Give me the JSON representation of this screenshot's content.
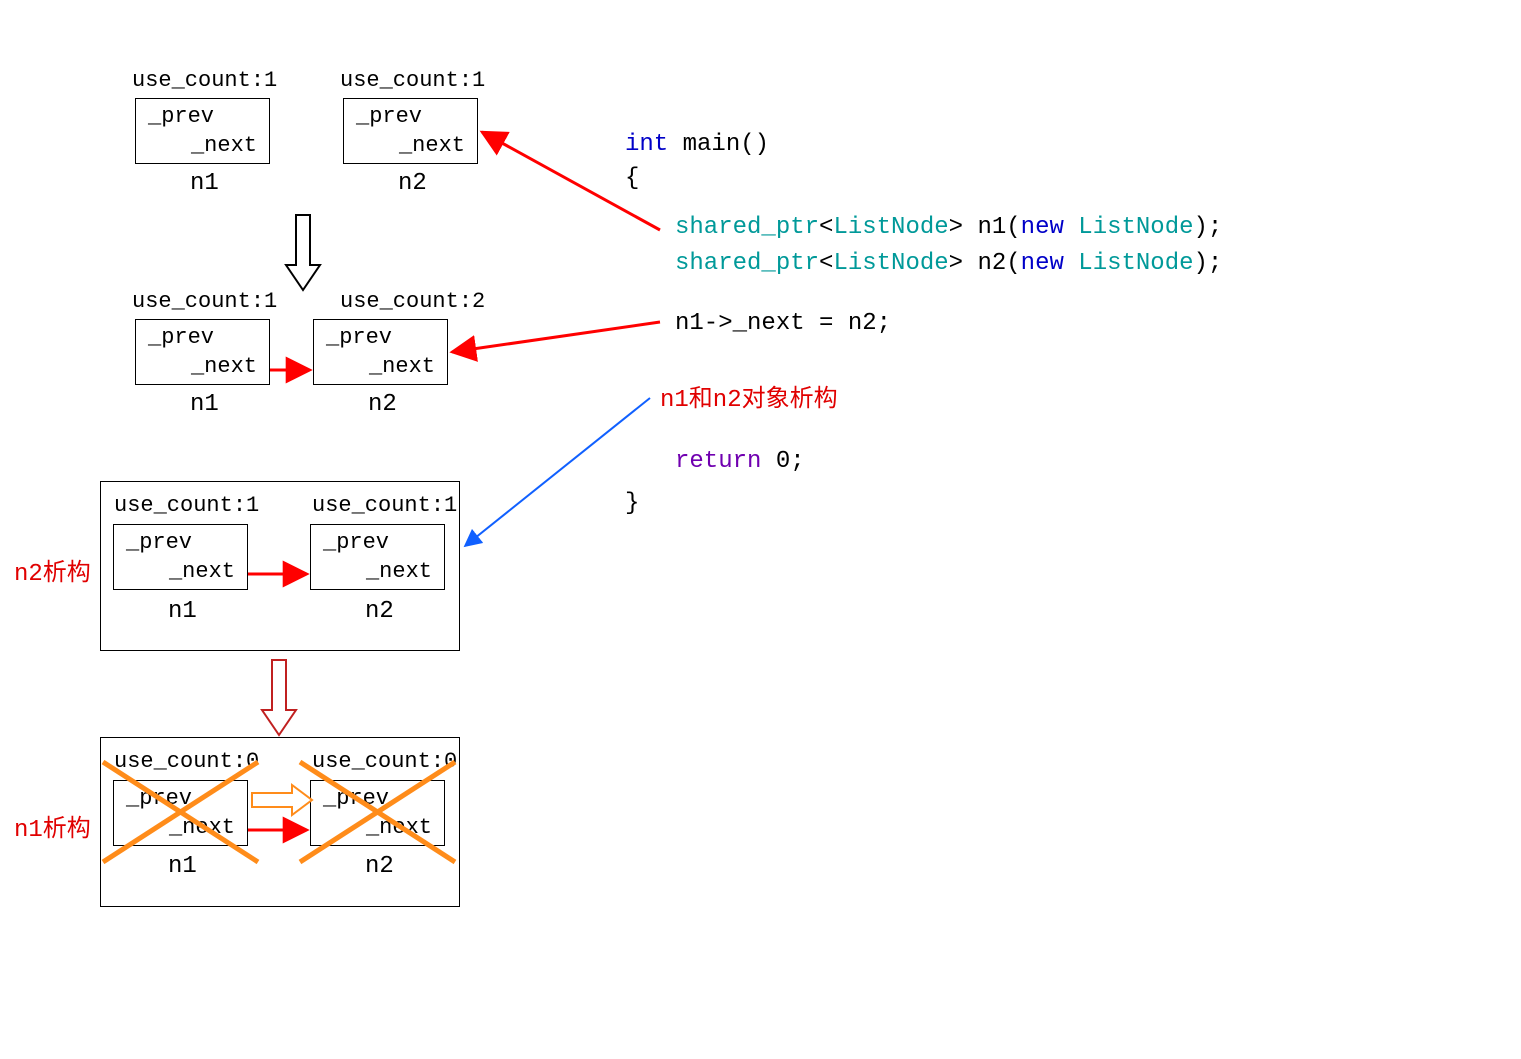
{
  "stage1": {
    "n1": {
      "use_count": "use_count:1",
      "prev": "_prev",
      "next": "_next",
      "name": "n1"
    },
    "n2": {
      "use_count": "use_count:1",
      "prev": "_prev",
      "next": "_next",
      "name": "n2"
    }
  },
  "stage2": {
    "n1": {
      "use_count": "use_count:1",
      "prev": "_prev",
      "next": "_next",
      "name": "n1"
    },
    "n2": {
      "use_count": "use_count:2",
      "prev": "_prev",
      "next": "_next",
      "name": "n2"
    }
  },
  "stage3": {
    "label": "n2析构",
    "n1": {
      "use_count": "use_count:1",
      "prev": "_prev",
      "next": "_next",
      "name": "n1"
    },
    "n2": {
      "use_count": "use_count:1",
      "prev": "_prev",
      "next": "_next",
      "name": "n2"
    }
  },
  "stage4": {
    "label": "n1析构",
    "n1": {
      "use_count": "use_count:0",
      "prev": "_prev",
      "next": "_next",
      "name": "n1"
    },
    "n2": {
      "use_count": "use_count:0",
      "prev": "_prev",
      "next": "_next",
      "name": "n2"
    }
  },
  "code": {
    "line1_int": "int",
    "line1_rest": " main()",
    "line2": "{",
    "line3_sp": "shared_ptr",
    "line3_lt": "<",
    "line3_ln": "ListNode",
    "line3_gt": "> n1(",
    "line3_new": "new",
    "line3_ln2": " ListNode",
    "line3_end": ");",
    "line4_sp": "shared_ptr",
    "line4_lt": "<",
    "line4_ln": "ListNode",
    "line4_gt": "> n2(",
    "line4_new": "new",
    "line4_ln2": " ListNode",
    "line4_end": ");",
    "line5": "n1->_next = n2;",
    "line6": "n1和n2对象析构",
    "line7_ret": "return",
    "line7_zero": " 0;",
    "line8": "}"
  }
}
